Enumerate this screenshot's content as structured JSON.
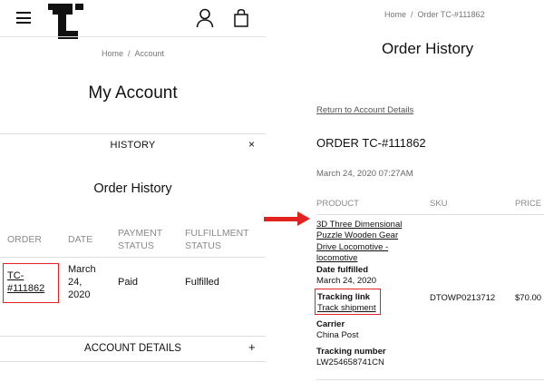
{
  "left": {
    "breadcrumb": {
      "home": "Home",
      "separator": "/",
      "current": "Account"
    },
    "page_title": "My Account",
    "history_section": {
      "label": "HISTORY",
      "close": "×"
    },
    "order_history_title": "Order History",
    "table": {
      "headers": {
        "order": "ORDER",
        "date": "DATE",
        "payment_1": "PAYMENT",
        "payment_2": "STATUS",
        "fulfillment_1": "FULFILLMENT",
        "fulfillment_2": "STATUS"
      },
      "row": {
        "order_1": "TC-",
        "order_2": "#111862",
        "date_1": "March",
        "date_2": "24,",
        "date_3": "2020",
        "payment": "Paid",
        "fulfillment": "Fulfilled"
      }
    },
    "account_details": {
      "label": "ACCOUNT DETAILS",
      "toggle": "+"
    }
  },
  "right": {
    "breadcrumb": {
      "home": "Home",
      "separator": "/",
      "current": "Order TC-#111862"
    },
    "title": "Order History",
    "return_link": "Return to Account Details",
    "order_number": "ORDER TC-#111862",
    "order_date": "March 24, 2020 07:27AM",
    "table_headers": {
      "product": "PRODUCT",
      "sku": "SKU",
      "price": "PRICE"
    },
    "item": {
      "product_lines": [
        "3D Three Dimensional",
        "Puzzle Wooden Gear",
        "Drive Locomotive -",
        "locomotive"
      ],
      "date_fulfilled_label": "Date fulfilled",
      "date_fulfilled": "March 24, 2020",
      "tracking_label": "Tracking link",
      "tracking_link": "Track shipment",
      "carrier_label": "Carrier",
      "carrier": "China Post",
      "tracking_number_label": "Tracking number",
      "tracking_number": "LW254658741CN",
      "sku": "DTOWP0213712",
      "price": "$70.00"
    }
  },
  "colors": {
    "highlight": "#e2221f",
    "muted_text": "#8a8a8a",
    "divider": "#dedede"
  }
}
